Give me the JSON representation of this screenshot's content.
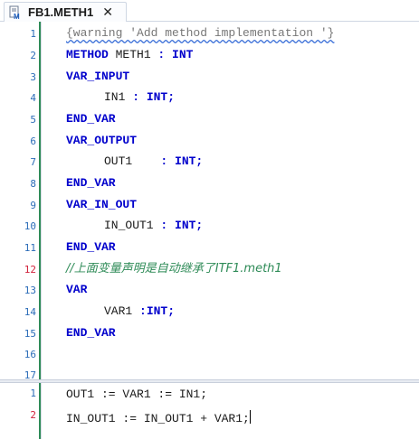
{
  "tab": {
    "title": "FB1.METH1",
    "close": "✕"
  },
  "declaration": {
    "line_numbers": [
      "1",
      "2",
      "3",
      "4",
      "5",
      "6",
      "7",
      "8",
      "9",
      "10",
      "11",
      "12",
      "13",
      "14",
      "15",
      "16",
      "17"
    ],
    "lines": {
      "l1": "{warning 'Add method implementation '}",
      "l2_kw": "METHOD",
      "l2_name": " METH1 ",
      "l2_colon": ":",
      "l2_type": " INT",
      "l3": "VAR_INPUT",
      "l4_name": "IN1 ",
      "l4_rest": ": INT;",
      "l5": "END_VAR",
      "l6": "VAR_OUTPUT",
      "l7_name": "OUT1    ",
      "l7_rest": ": INT;",
      "l8": "END_VAR",
      "l9": "VAR_IN_OUT",
      "l10_name": "IN_OUT1 ",
      "l10_rest": ": INT;",
      "l11": "END_VAR",
      "l12": "//上面变量声明是自动继承了ITF1.meth1",
      "l13": "VAR",
      "l14_name": "VAR1 ",
      "l14_rest": ":INT;",
      "l15": "END_VAR"
    }
  },
  "implementation": {
    "line_numbers": [
      "1",
      "2"
    ],
    "line1": "OUT1 := VAR1 := IN1;",
    "line2": "IN_OUT1 := IN_OUT1 + VAR1;"
  },
  "colors": {
    "keyword": "#0000cc",
    "comment": "#777777",
    "chinese_comment": "#2e8b57",
    "line_number": "#2b6cb8",
    "marked_line_number": "#d0203a"
  }
}
